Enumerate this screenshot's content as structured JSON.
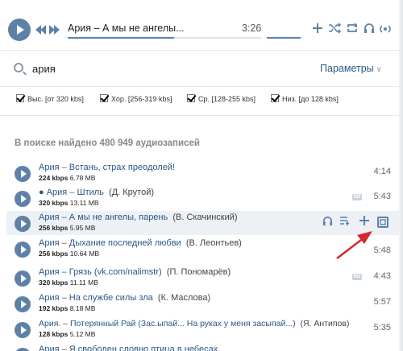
{
  "player": {
    "now_artist": "Ария",
    "now_sep": " – ",
    "now_song": "А мы не ангелы...",
    "time": "3:26",
    "progress": 0.55,
    "icons": [
      "plus-icon",
      "shuffle-icon",
      "repeat-icon",
      "headphones-icon",
      "broadcast-icon"
    ]
  },
  "search": {
    "value": "ария",
    "params_label": "Параметры",
    "params_chevron": "∨"
  },
  "filters": [
    {
      "label": "Выс. [от 320 kbs]"
    },
    {
      "label": "Хор. [256-319 kbs]"
    },
    {
      "label": "Ср. [128-255 kbs]"
    },
    {
      "label": "Низ. [до 128 kbs]"
    }
  ],
  "results": {
    "count_label": "В поиске найдено 480 949 аудиозаписей"
  },
  "tracks": [
    {
      "artist": "Ария",
      "song": "Встань, страх преодолей!",
      "sub": "",
      "bitrate": "224 kbps",
      "size": "6.78 MB",
      "time": "4:14",
      "hd": false
    },
    {
      "artist": "● Ария",
      "song": "Штиль",
      "sub": "(Д. Крутой)",
      "bitrate": "320 kbps",
      "size": "13.11 MB",
      "time": "5:43",
      "hd": true
    },
    {
      "artist": "Ария",
      "song": "А мы не ангелы, парень",
      "sub": "(В. Скачинский)",
      "bitrate": "256 kbps",
      "size": "5.95 MB",
      "time": "",
      "hd": false
    },
    {
      "artist": "Ария",
      "song": "Дыхание последней любви",
      "sub": "(В. Леонтьев)",
      "bitrate": "256 kbps",
      "size": "10.64 MB",
      "time": "5:48",
      "hd": false
    },
    {
      "artist": "Ария",
      "song": "Грязь (vk.com/nalimstr)",
      "sub": "(П. Пономарёв)",
      "bitrate": "320 kbps",
      "size": "11.11 MB",
      "time": "4:43",
      "hd": true
    },
    {
      "artist": "Ария",
      "song": "На службе силы зла",
      "sub": "(К. Маслова)",
      "bitrate": "192 kbps",
      "size": "8.18 MB",
      "time": "5:57",
      "hd": false
    },
    {
      "artist": "Ария.",
      "song": "Потерянный Рай (Зас.ыпай... На руках у меня засыпай...)",
      "sub": "(Я. Антипов)",
      "bitrate": "128 kbps",
      "size": "5.12 MB",
      "time": "5:35",
      "hd": false
    },
    {
      "artist": "Ария",
      "song": "Я свободен словно птица в небесах",
      "sub": "",
      "bitrate": "",
      "size": "",
      "time": "",
      "hd": false
    }
  ],
  "active_row_actions": [
    "headphones-icon",
    "add-to-playlist-icon",
    "plus-icon",
    "download-box-icon"
  ],
  "colors": {
    "accent": "#5e81a8",
    "link": "#2a5885",
    "active_row": "#edf0f5",
    "arrow": "#d22a2a"
  },
  "dash": " – "
}
